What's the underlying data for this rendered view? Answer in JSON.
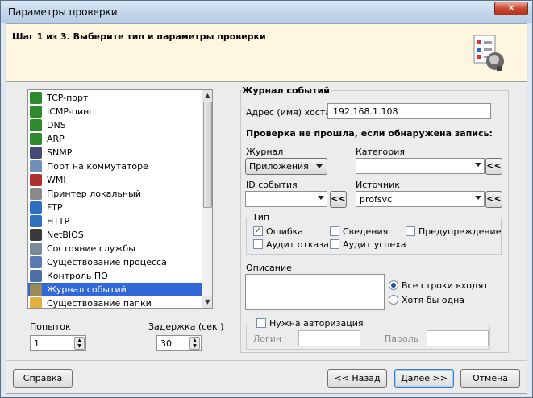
{
  "window": {
    "title": "Параметры проверки",
    "close_symbol": "✕"
  },
  "header": {
    "step_text": "Шаг 1 из 3. Выберите тип и параметры проверки"
  },
  "check_list": {
    "items": [
      {
        "label": "TCP-порт",
        "icon": "tcp-icon",
        "color": "#2d8a2d"
      },
      {
        "label": "ICMP-пинг",
        "icon": "icmp-icon",
        "color": "#2d8a2d"
      },
      {
        "label": "DNS",
        "icon": "dns-icon",
        "color": "#2d8a2d"
      },
      {
        "label": "ARP",
        "icon": "arp-icon",
        "color": "#2d8a2d"
      },
      {
        "label": "SNMP",
        "icon": "snmp-icon",
        "color": "#4a4a7a"
      },
      {
        "label": "Порт на коммутаторе",
        "icon": "switch-port-icon",
        "color": "#6f8fb8"
      },
      {
        "label": "WMI",
        "icon": "wmi-icon",
        "color": "#b03030"
      },
      {
        "label": "Принтер локальный",
        "icon": "printer-icon",
        "color": "#8a8a8a"
      },
      {
        "label": "FTP",
        "icon": "ftp-icon",
        "color": "#2f6fbf"
      },
      {
        "label": "HTTP",
        "icon": "http-icon",
        "color": "#2f6fbf"
      },
      {
        "label": "NetBIOS",
        "icon": "netbios-icon",
        "color": "#3a3a3a"
      },
      {
        "label": "Состояние службы",
        "icon": "service-icon",
        "color": "#7a8a9a"
      },
      {
        "label": "Существование процесса",
        "icon": "process-icon",
        "color": "#5a7ab0"
      },
      {
        "label": "Контроль ПО",
        "icon": "software-icon",
        "color": "#4a6fa0"
      },
      {
        "label": "Журнал событий",
        "icon": "event-log-icon",
        "color": "#9a8a5a"
      },
      {
        "label": "Существование папки",
        "icon": "folder-icon",
        "color": "#e0b040"
      }
    ],
    "selected_index": 14
  },
  "attempts": {
    "label": "Попыток",
    "value": "1"
  },
  "delay": {
    "label": "Задержка (сек.)",
    "value": "30"
  },
  "event_log": {
    "title": "Журнал событий",
    "host_label": "Адрес (имя) хоста",
    "host_value": "192.168.1.108",
    "fail_condition": "Проверка не прошла, если обнаружена запись:",
    "journal_label": "Журнал",
    "journal_value": "Приложения",
    "category_label": "Категория",
    "category_value": "",
    "event_id_label": "ID события",
    "event_id_value": "",
    "source_label": "Источник",
    "source_value": "profsvc",
    "pick_symbol": "<<",
    "type_group": "Тип",
    "types": [
      {
        "label": "Ошибка",
        "checked": true
      },
      {
        "label": "Сведения",
        "checked": false
      },
      {
        "label": "Предупреждение",
        "checked": false
      },
      {
        "label": "Аудит отказа",
        "checked": false
      },
      {
        "label": "Аудит успеха",
        "checked": false
      }
    ],
    "description_label": "Описание",
    "match_options": [
      {
        "label": "Все строки входят",
        "selected": true
      },
      {
        "label": "Хотя бы одна",
        "selected": false
      }
    ],
    "auth": {
      "label": "Нужна авторизация",
      "checked": false,
      "login_label": "Логин",
      "password_label": "Пароль"
    }
  },
  "buttons": {
    "help": "Справка",
    "back": "<< Назад",
    "next": "Далее >>",
    "cancel": "Отмена"
  }
}
